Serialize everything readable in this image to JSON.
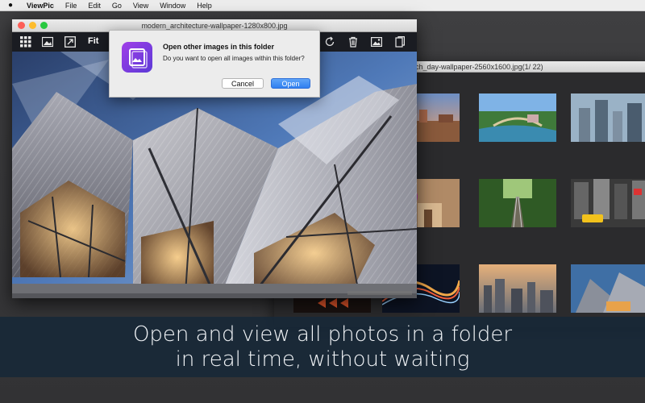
{
  "menubar": {
    "apple": "",
    "items": [
      "ViewPic",
      "File",
      "Edit",
      "Go",
      "View",
      "Window",
      "Help"
    ]
  },
  "back_window": {
    "title": "ach_day-wallpaper-2560x1600.jpg(1/ 22)",
    "thumbnails": [
      "city-old-town",
      "river-bridge-town",
      "skyscrapers-aerial",
      "flower-alley",
      "railway-forest",
      "new-york-taxi",
      "neon-arrow-sign",
      "light-trails-road",
      "city-aerial-sunset",
      "modern-architecture"
    ]
  },
  "front_window": {
    "title": "modern_architecture-wallpaper-1280x800.jpg",
    "toolbar": {
      "fit_label": "Fit",
      "icons": [
        "grid-icon",
        "image-icon",
        "expand-icon",
        "rotate-icon",
        "trash-icon",
        "gallery-icon",
        "export-icon"
      ]
    }
  },
  "dialog": {
    "title": "Open other images in this folder",
    "message": "Do you want to open all images within this folder?",
    "cancel_label": "Cancel",
    "open_label": "Open"
  },
  "caption": {
    "line1": "Open and view all photos in a folder",
    "line2": "in real time, without waiting"
  },
  "colors": {
    "accent": "#2f7ff0",
    "caption_band": "#172838",
    "traffic_red": "#fd5f57",
    "traffic_yellow": "#fdbc2d",
    "traffic_green": "#28c840"
  }
}
